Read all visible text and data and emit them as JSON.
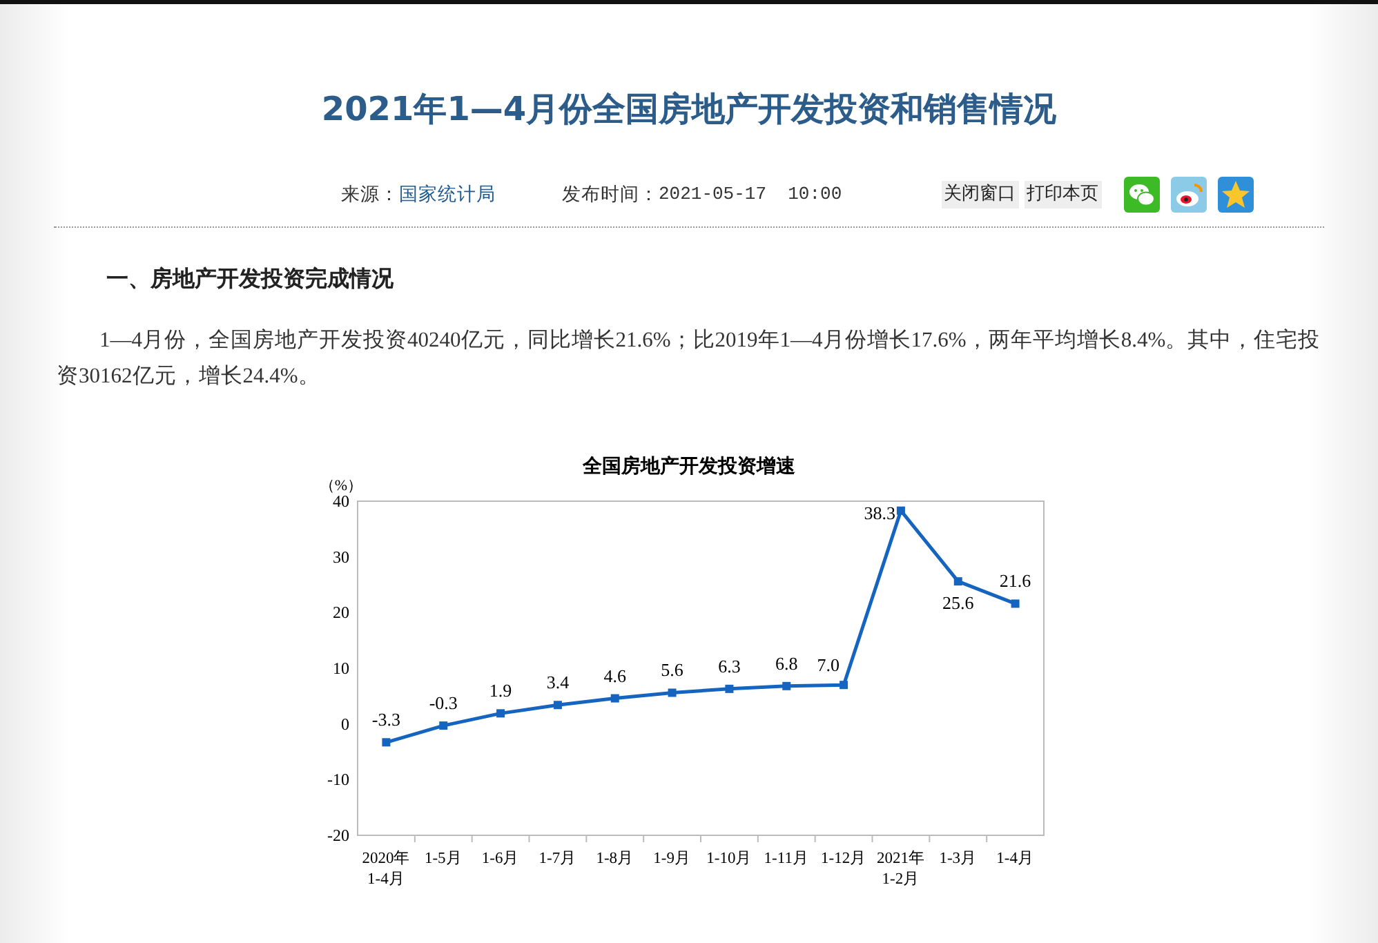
{
  "title": "2021年1—4月份全国房地产开发投资和销售情况",
  "meta": {
    "source_label": "来源：",
    "source": "国家统计局",
    "time_label": "发布时间：",
    "time": "2021-05-17  10:00",
    "actions": [
      "关闭窗口",
      "打印本页"
    ],
    "share": [
      {
        "kind": "wechat"
      },
      {
        "kind": "weibo"
      },
      {
        "kind": "qzone"
      }
    ]
  },
  "section_heading": "一、房地产开发投资完成情况",
  "paragraph": "1—4月份，全国房地产开发投资40240亿元，同比增长21.6%；比2019年1—4月份增长17.6%，两年平均增长8.4%。其中，住宅投资30162亿元，增长24.4%。",
  "chart": {
    "chart_data": {
      "type": "line",
      "title": "全国房地产开发投资增速",
      "ylabel": "（%）",
      "categories": [
        "2020年\n1-4月",
        "1-5月",
        "1-6月",
        "1-7月",
        "1-8月",
        "1-9月",
        "1-10月",
        "1-11月",
        "1-12月",
        "2021年\n1-2月",
        "1-3月",
        "1-4月"
      ],
      "series": [
        {
          "color": "#1565c0",
          "marker": "square",
          "values": [
            -3.3,
            -0.3,
            1.9,
            3.4,
            4.6,
            5.6,
            6.3,
            6.8,
            7.0,
            38.3,
            25.6,
            21.6
          ]
        }
      ],
      "ylim": [
        -20,
        40
      ],
      "yticks": [
        -20,
        -10,
        0,
        10,
        20,
        30,
        40
      ],
      "value_labels": [
        "-3.3",
        "-0.3",
        "1.9",
        "3.4",
        "4.6",
        "5.6",
        "6.3",
        "6.8",
        "7.0",
        "38.3",
        "25.6",
        "21.6"
      ]
    }
  }
}
